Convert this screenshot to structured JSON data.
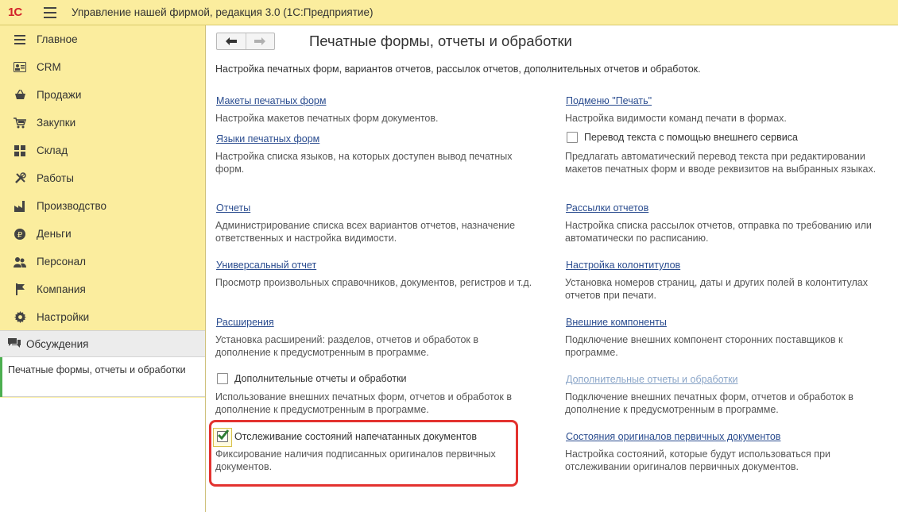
{
  "app": {
    "logo": "1С",
    "title": "Управление нашей фирмой, редакция 3.0  (1С:Предприятие)"
  },
  "sidebar": {
    "items": [
      {
        "label": "Главное",
        "icon": "menu-lines-icon"
      },
      {
        "label": "CRM",
        "icon": "contact-card-icon"
      },
      {
        "label": "Продажи",
        "icon": "basket-icon"
      },
      {
        "label": "Закупки",
        "icon": "cart-icon"
      },
      {
        "label": "Склад",
        "icon": "grid-icon"
      },
      {
        "label": "Работы",
        "icon": "tools-icon"
      },
      {
        "label": "Производство",
        "icon": "factory-icon"
      },
      {
        "label": "Деньги",
        "icon": "coin-icon"
      },
      {
        "label": "Персонал",
        "icon": "people-icon"
      },
      {
        "label": "Компания",
        "icon": "flag-icon"
      },
      {
        "label": "Настройки",
        "icon": "gear-icon"
      }
    ],
    "discussions": "Обсуждения",
    "open_window": "Печатные формы, отчеты и обработки"
  },
  "main": {
    "title": "Печатные формы, отчеты и обработки",
    "description": "Настройка печатных форм, вариантов отчетов, рассылок отчетов, дополнительных отчетов и обработок.",
    "left": {
      "makety_link": "Макеты печатных форм",
      "makety_note": "Настройка макетов печатных форм документов.",
      "languages_link": "Языки печатных форм",
      "languages_note": "Настройка списка языков, на которых доступен вывод печатных форм.",
      "reports_link": "Отчеты",
      "reports_note": "Администрирование списка всех вариантов отчетов, назначение ответственных и настройка видимости.",
      "universal_link": "Универсальный отчет",
      "universal_note": "Просмотр произвольных справочников, документов, регистров и т.д.",
      "extensions_link": "Расширения",
      "extensions_note": "Установка расширений: разделов, отчетов и обработок в дополнение к предусмотренным в программе.",
      "addreports_checkbox": "Дополнительные отчеты и обработки",
      "addreports_note": "Использование внешних печатных форм, отчетов и обработок в дополнение к предусмотренным в программе.",
      "tracking_checkbox": "Отслеживание состояний напечатанных документов",
      "tracking_note": "Фиксирование наличия подписанных оригиналов первичных документов."
    },
    "right": {
      "print_submenu_link": "Подменю \"Печать\"",
      "print_submenu_note": "Настройка видимости команд печати в формах.",
      "translate_checkbox": "Перевод текста с помощью внешнего сервиса",
      "translate_note": "Предлагать автоматический перевод текста при редактировании макетов печатных форм и вводе реквизитов на выбранных языках.",
      "mailing_link": "Рассылки отчетов",
      "mailing_note": "Настройка списка рассылок отчетов, отправка по требованию или автоматически по расписанию.",
      "footers_link": "Настройка колонтитулов",
      "footers_note": "Установка номеров страниц, даты и других полей в колонтитулах отчетов при печати.",
      "external_link": "Внешние компоненты",
      "external_note": "Подключение внешних компонент сторонних поставщиков к программе.",
      "addreports_link": "Дополнительные отчеты и обработки",
      "addreports_note": "Подключение внешних печатных форм, отчетов и обработок в дополнение к предусмотренным в программе.",
      "originals_link": "Состояния оригиналов первичных документов",
      "originals_note": "Настройка состояний, которые будут использоваться при отслеживании оригиналов первичных документов."
    },
    "checkbox_states": {
      "translate": false,
      "addreports": false,
      "tracking": true
    }
  },
  "colors": {
    "sidebar_bg": "#fbed9e",
    "link": "#2a4c8f",
    "link_disabled": "#8aa5c8",
    "highlight": "#e3322f",
    "check": "#2e7d32"
  }
}
